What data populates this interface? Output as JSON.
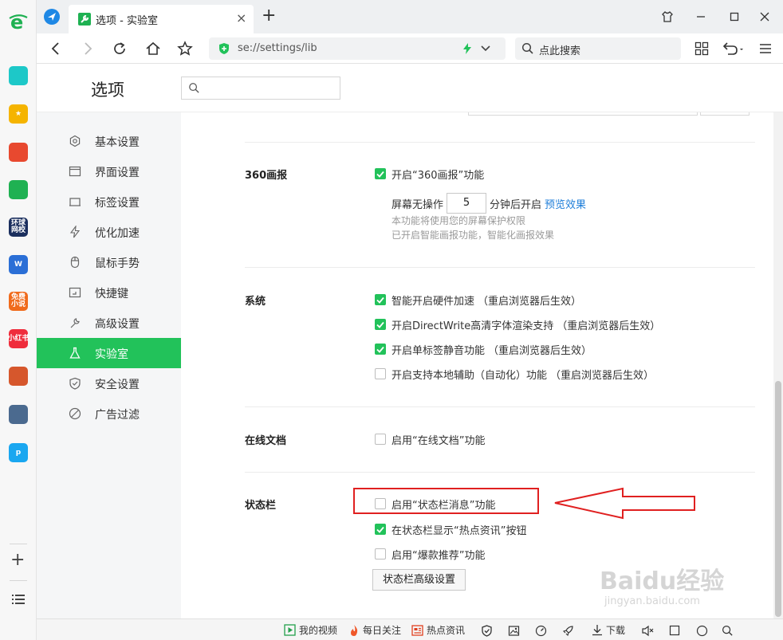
{
  "tab": {
    "title": "选项 - 实验室",
    "add": "+"
  },
  "address": {
    "url": "se://settings/lib"
  },
  "search": {
    "placeholder": "点此搜索"
  },
  "settings": {
    "title": "选项",
    "search_value": ""
  },
  "rail_apps": [
    {
      "name": "app-health",
      "color": "#1dc8c8",
      "text": ""
    },
    {
      "name": "app-favorites",
      "color": "#f5b400",
      "text": "★"
    },
    {
      "name": "app-weibo",
      "color": "#e8492f",
      "text": ""
    },
    {
      "name": "app-mail",
      "color": "#1fb152",
      "text": ""
    },
    {
      "name": "app-news",
      "color": "#1b2f5e",
      "text": "环球\n网校"
    },
    {
      "name": "app-doc",
      "color": "#2b6fd6",
      "text": "W"
    },
    {
      "name": "app-novel",
      "color": "#f06b1c",
      "text": "免费\n小说"
    },
    {
      "name": "app-xiaohongshu",
      "color": "#ef2d3c",
      "text": "小红书"
    },
    {
      "name": "app-game1",
      "color": "#d6572c",
      "text": ""
    },
    {
      "name": "app-game2",
      "color": "#4b6a8f",
      "text": ""
    },
    {
      "name": "app-p",
      "color": "#1aa7f0",
      "text": "p"
    }
  ],
  "sidebar": {
    "items": [
      {
        "label": "基本设置",
        "icon": "gear-icon"
      },
      {
        "label": "界面设置",
        "icon": "window-icon"
      },
      {
        "label": "标签设置",
        "icon": "tab-icon"
      },
      {
        "label": "优化加速",
        "icon": "lightning-icon"
      },
      {
        "label": "鼠标手势",
        "icon": "mouse-icon"
      },
      {
        "label": "快捷键",
        "icon": "keyboard-icon"
      },
      {
        "label": "高级设置",
        "icon": "wrench-icon"
      },
      {
        "label": "实验室",
        "icon": "flask-icon",
        "active": true
      },
      {
        "label": "安全设置",
        "icon": "shield-icon"
      },
      {
        "label": "广告过滤",
        "icon": "block-icon"
      }
    ]
  },
  "sections": {
    "huabao": {
      "title": "360画报",
      "enable_label": "开启“360画报”功能",
      "enable_checked": true,
      "idle_prefix": "屏幕无操作",
      "idle_minutes": "5",
      "idle_suffix": "分钟后开启",
      "preview_link": "预览效果",
      "note1": "本功能将使用您的屏幕保护权限",
      "note2": "已开启智能画报功能，智能化画报效果"
    },
    "system": {
      "title": "系统",
      "options": [
        {
          "label": "智能开启硬件加速",
          "hint": "（重启浏览器后生效）",
          "checked": true
        },
        {
          "label": "开启DirectWrite高清字体渲染支持",
          "hint": "（重启浏览器后生效）",
          "checked": true
        },
        {
          "label": "开启单标签静音功能",
          "hint": "（重启浏览器后生效）",
          "checked": true
        },
        {
          "label": "开启支持本地辅助（自动化）功能",
          "hint": "（重启浏览器后生效）",
          "checked": false
        }
      ]
    },
    "online_doc": {
      "title": "在线文档",
      "option": {
        "label": "启用“在线文档”功能",
        "checked": false
      }
    },
    "statusbar": {
      "title": "状态栏",
      "options": [
        {
          "label": "启用“状态栏消息”功能",
          "checked": false
        },
        {
          "label": "在状态栏显示“热点资讯”按钮",
          "checked": true
        },
        {
          "label": "启用“爆款推荐”功能",
          "checked": false
        }
      ],
      "advanced_button": "状态栏高级设置"
    }
  },
  "statusbar": {
    "my_video": "我的视频",
    "daily_follow": "每日关注",
    "hot_news": "热点资讯",
    "download": "下载"
  },
  "watermark": {
    "brand": "Baidu经验",
    "url": "jingyan.baidu.com"
  },
  "colors": {
    "accent": "#22c25a",
    "annotation": "#e02020",
    "link": "#1e7ed9"
  }
}
